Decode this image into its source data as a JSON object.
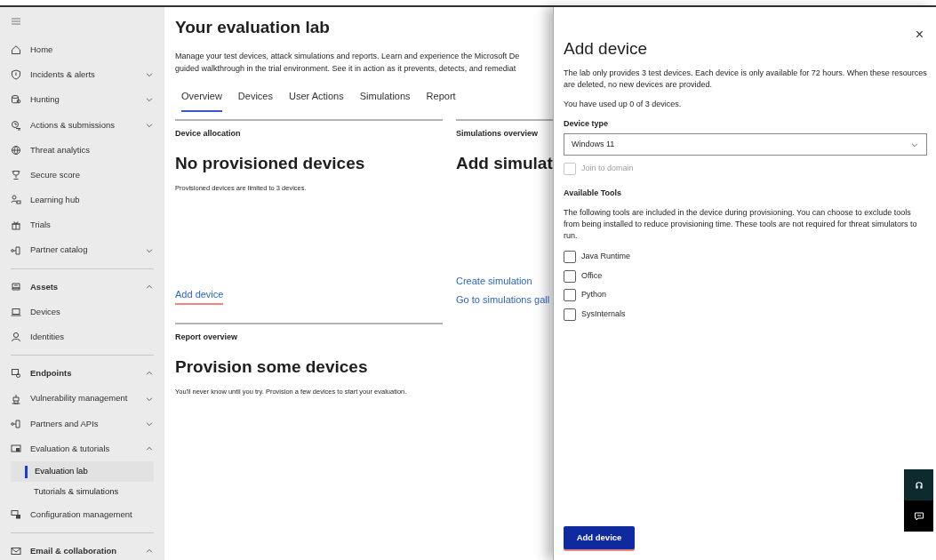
{
  "sidebar": {
    "sections": [
      [
        {
          "label": "Home",
          "kind": "item"
        },
        {
          "label": "Incidents & alerts",
          "kind": "item",
          "expanded": false
        },
        {
          "label": "Hunting",
          "kind": "item",
          "expanded": false
        },
        {
          "label": "Actions & submissions",
          "kind": "item",
          "expanded": false
        },
        {
          "label": "Threat analytics",
          "kind": "item"
        },
        {
          "label": "Secure score",
          "kind": "item"
        },
        {
          "label": "Learning hub",
          "kind": "item"
        },
        {
          "label": "Trials",
          "kind": "item"
        },
        {
          "label": "Partner catalog",
          "kind": "item",
          "expanded": false
        }
      ],
      [
        {
          "label": "Assets",
          "kind": "header",
          "expanded": true
        },
        {
          "label": "Devices",
          "kind": "item"
        },
        {
          "label": "Identities",
          "kind": "item"
        }
      ],
      [
        {
          "label": "Endpoints",
          "kind": "header",
          "expanded": true
        },
        {
          "label": "Vulnerability management",
          "kind": "item",
          "expanded": false
        },
        {
          "label": "Partners and APIs",
          "kind": "item",
          "expanded": false
        },
        {
          "label": "Evaluation & tutorials",
          "kind": "item",
          "expanded": true,
          "children": [
            {
              "label": "Evaluation lab",
              "selected": true
            },
            {
              "label": "Tutorials & simulations",
              "selected": false
            }
          ]
        },
        {
          "label": "Configuration management",
          "kind": "item"
        }
      ],
      [
        {
          "label": "Email & collaboration",
          "kind": "header",
          "expanded": true
        }
      ]
    ]
  },
  "main": {
    "title": "Your evaluation lab",
    "description_lines": [
      "Manage your test devices, attack simulations and reports. Learn and experience the Microsoft De",
      "guided walkthrough in the trial environment. See it in action as it prevents, detects, and remediat"
    ],
    "tabs": [
      {
        "label": "Overview",
        "selected": true
      },
      {
        "label": "Devices",
        "selected": false
      },
      {
        "label": "User Actions",
        "selected": false
      },
      {
        "label": "Simulations",
        "selected": false
      },
      {
        "label": "Report",
        "selected": false
      }
    ],
    "device_allocation": {
      "label": "Device allocation",
      "heading": "No provisioned devices",
      "note": "Provisioned devices are limited to 3 devices.",
      "links": [
        "Add device"
      ]
    },
    "simulations_overview": {
      "label": "Simulations overview",
      "heading": "Add simulat",
      "links": [
        "Create simulation",
        "Go to simulations gall"
      ]
    },
    "report_overview": {
      "label": "Report overview",
      "heading": "Provision some devices",
      "note": "You'll never know until you try. Provision a few devices to start your evaluation."
    }
  },
  "panel": {
    "close": "×",
    "title": "Add device",
    "description": "The lab only provides 3 test devices. Each device is only available for 72 hours. When these resources are deleted, no new devices are provided.",
    "usage": "You have used up 0 of 3 devices.",
    "device_type": {
      "label": "Device type",
      "value": "Windows 11"
    },
    "join_domain": {
      "label": "Join to domain",
      "checked": false,
      "disabled": true
    },
    "tools_heading": "Available Tools",
    "tools_description": "The following tools are included in the device during provisioning. You can choose to exclude tools from being installed to reduce provisioning time. These tools are not required for threat simulators to run.",
    "tools": [
      {
        "label": "Java Runtime",
        "checked": false
      },
      {
        "label": "Office",
        "checked": false
      },
      {
        "label": "Python",
        "checked": false
      },
      {
        "label": "SysInternals",
        "checked": false
      }
    ],
    "button": "Add device"
  }
}
